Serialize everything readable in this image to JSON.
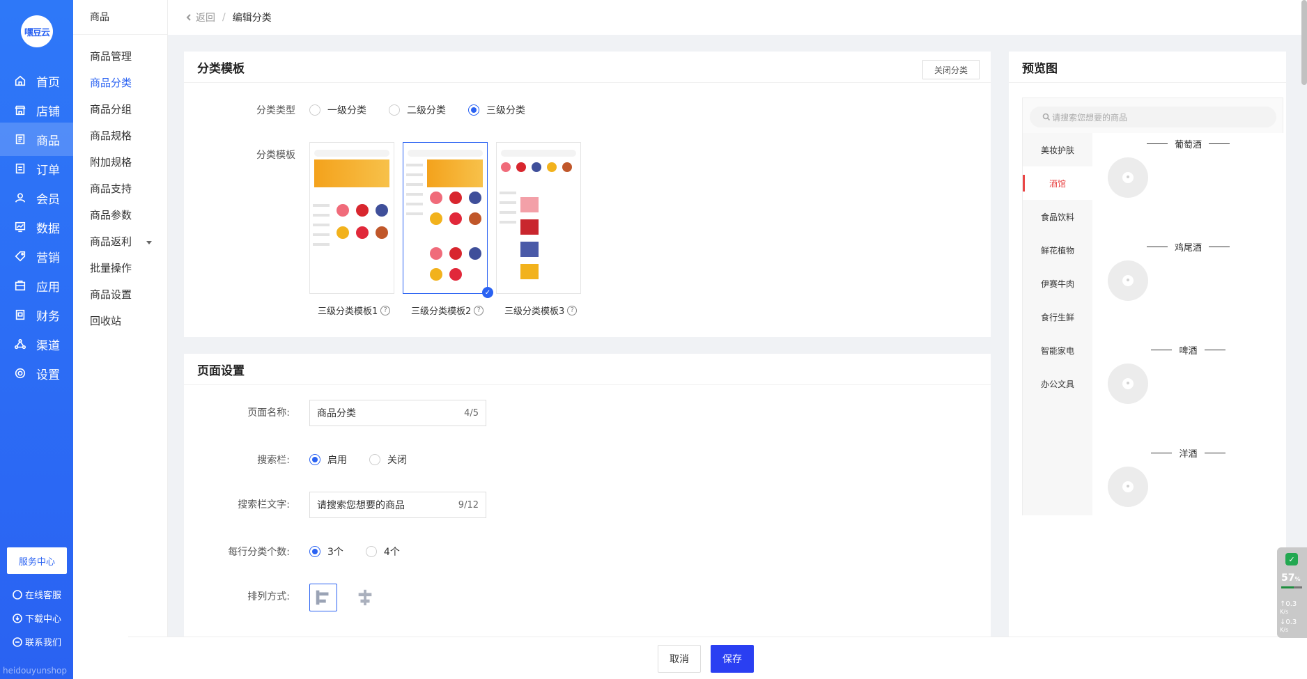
{
  "brand": {
    "logo_text": "嘿豆云",
    "watermark": "heidouyunshop"
  },
  "nav": {
    "items": [
      {
        "label": "首页",
        "icon": "home-icon",
        "active": false
      },
      {
        "label": "店铺",
        "icon": "shop-icon",
        "active": false
      },
      {
        "label": "商品",
        "icon": "goods-icon",
        "active": true
      },
      {
        "label": "订单",
        "icon": "order-icon",
        "active": false
      },
      {
        "label": "会员",
        "icon": "member-icon",
        "active": false
      },
      {
        "label": "数据",
        "icon": "data-icon",
        "active": false
      },
      {
        "label": "营销",
        "icon": "tag-icon",
        "active": false
      },
      {
        "label": "应用",
        "icon": "app-icon",
        "active": false
      },
      {
        "label": "财务",
        "icon": "finance-icon",
        "active": false
      },
      {
        "label": "渠道",
        "icon": "channel-icon",
        "active": false
      },
      {
        "label": "设置",
        "icon": "gear-icon",
        "active": false
      }
    ],
    "service_center": "服务中心",
    "online_service": "在线客服",
    "download_center": "下载中心",
    "contact_us": "联系我们"
  },
  "subnav": {
    "title": "商品",
    "items": [
      "商品管理",
      "商品分类",
      "商品分组",
      "商品规格",
      "附加规格",
      "商品支持",
      "商品参数",
      "商品返利",
      "批量操作",
      "商品设置",
      "回收站"
    ],
    "active_index": 1
  },
  "breadcrumb": {
    "back": "返回",
    "current": "编辑分类"
  },
  "template_card": {
    "title": "分类模板",
    "close_btn": "关闭分类",
    "type_label": "分类类型",
    "type_options": [
      "一级分类",
      "二级分类",
      "三级分类"
    ],
    "type_selected": 2,
    "template_label": "分类模板",
    "templates": [
      "三级分类模板1",
      "三级分类模板2",
      "三级分类模板3"
    ],
    "template_selected": 1,
    "help_mark": "?"
  },
  "page_card": {
    "title": "页面设置",
    "page_name_label": "页面名称:",
    "page_name_value": "商品分类",
    "page_name_count": "4/5",
    "search_label": "搜索栏:",
    "search_options": [
      "启用",
      "关闭"
    ],
    "search_text_label": "搜索栏文字:",
    "search_text_value": "请搜索您想要的商品",
    "search_text_count": "9/12",
    "per_row_label": "每行分类个数:",
    "per_row_options": [
      "3个",
      "4个"
    ],
    "sort_label": "排列方式:"
  },
  "preview": {
    "title": "预览图",
    "search_placeholder": "请搜索您想要的商品",
    "side_items": [
      "美妆护肤",
      "酒馆",
      "食品饮料",
      "鲜花植物",
      "伊赛牛肉",
      "食行生鲜",
      "智能家电",
      "办公文具"
    ],
    "side_active": 1,
    "sections": [
      "葡萄酒",
      "鸡尾酒",
      "啤酒",
      "洋酒"
    ]
  },
  "actions": {
    "cancel": "取消",
    "save": "保存"
  },
  "net_widget": {
    "percent": "57",
    "percent_unit": "%",
    "up": "0.3",
    "down": "0.3",
    "unit": "K/s"
  },
  "colors": {
    "primary": "#2a62f2",
    "save": "#2a3ff2",
    "accent_red": "#e94545"
  }
}
